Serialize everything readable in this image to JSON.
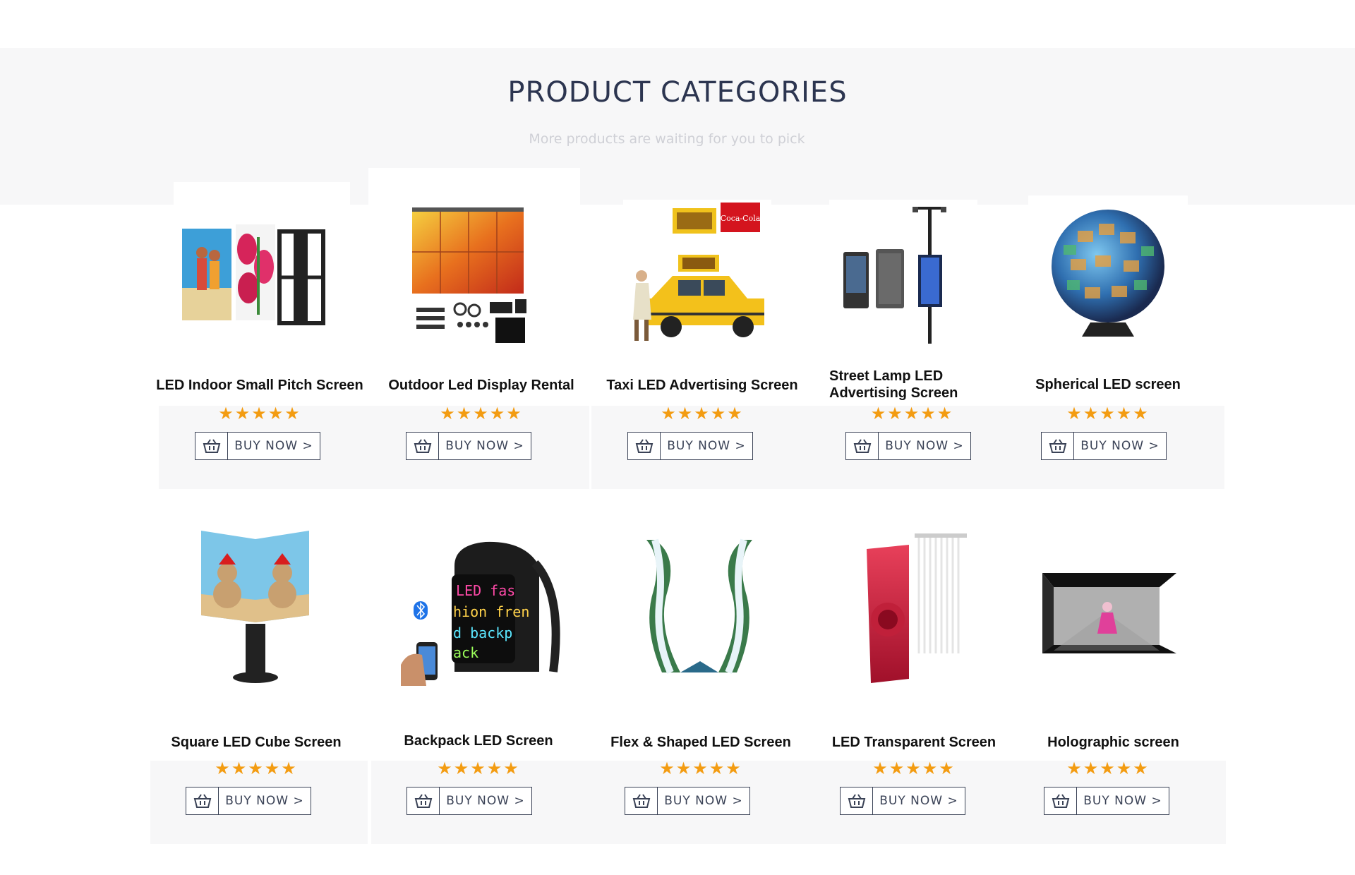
{
  "header": {
    "title": "PRODUCT CATEGORIES",
    "subtitle": "More products are waiting for you to pick"
  },
  "buy_label": "BUY NOW >",
  "rating_stars": "★★★★★",
  "colors": {
    "heading": "#2c3550",
    "star": "#f39c12",
    "button_border": "#3a4256",
    "band": "#f7f7f8"
  },
  "products": [
    {
      "title": "LED Indoor Small Pitch Screen",
      "rating": 5
    },
    {
      "title": "Outdoor Led Display Rental",
      "rating": 5
    },
    {
      "title": "Taxi LED Advertising Screen",
      "rating": 5
    },
    {
      "title": "Street Lamp LED Advertising Screen",
      "rating": 5
    },
    {
      "title": "Spherical LED screen",
      "rating": 5
    },
    {
      "title": "Square LED Cube Screen",
      "rating": 5
    },
    {
      "title": "Backpack LED Screen",
      "rating": 5
    },
    {
      "title": "Flex & Shaped LED Screen",
      "rating": 5
    },
    {
      "title": "LED Transparent Screen",
      "rating": 5
    },
    {
      "title": "Holographic screen",
      "rating": 5
    }
  ],
  "icons": {
    "buy": "shopping-basket-icon",
    "bluetooth": "bluetooth-icon"
  },
  "backpack_text": [
    "LED fas",
    "hion fren",
    "d backp",
    "ack"
  ]
}
